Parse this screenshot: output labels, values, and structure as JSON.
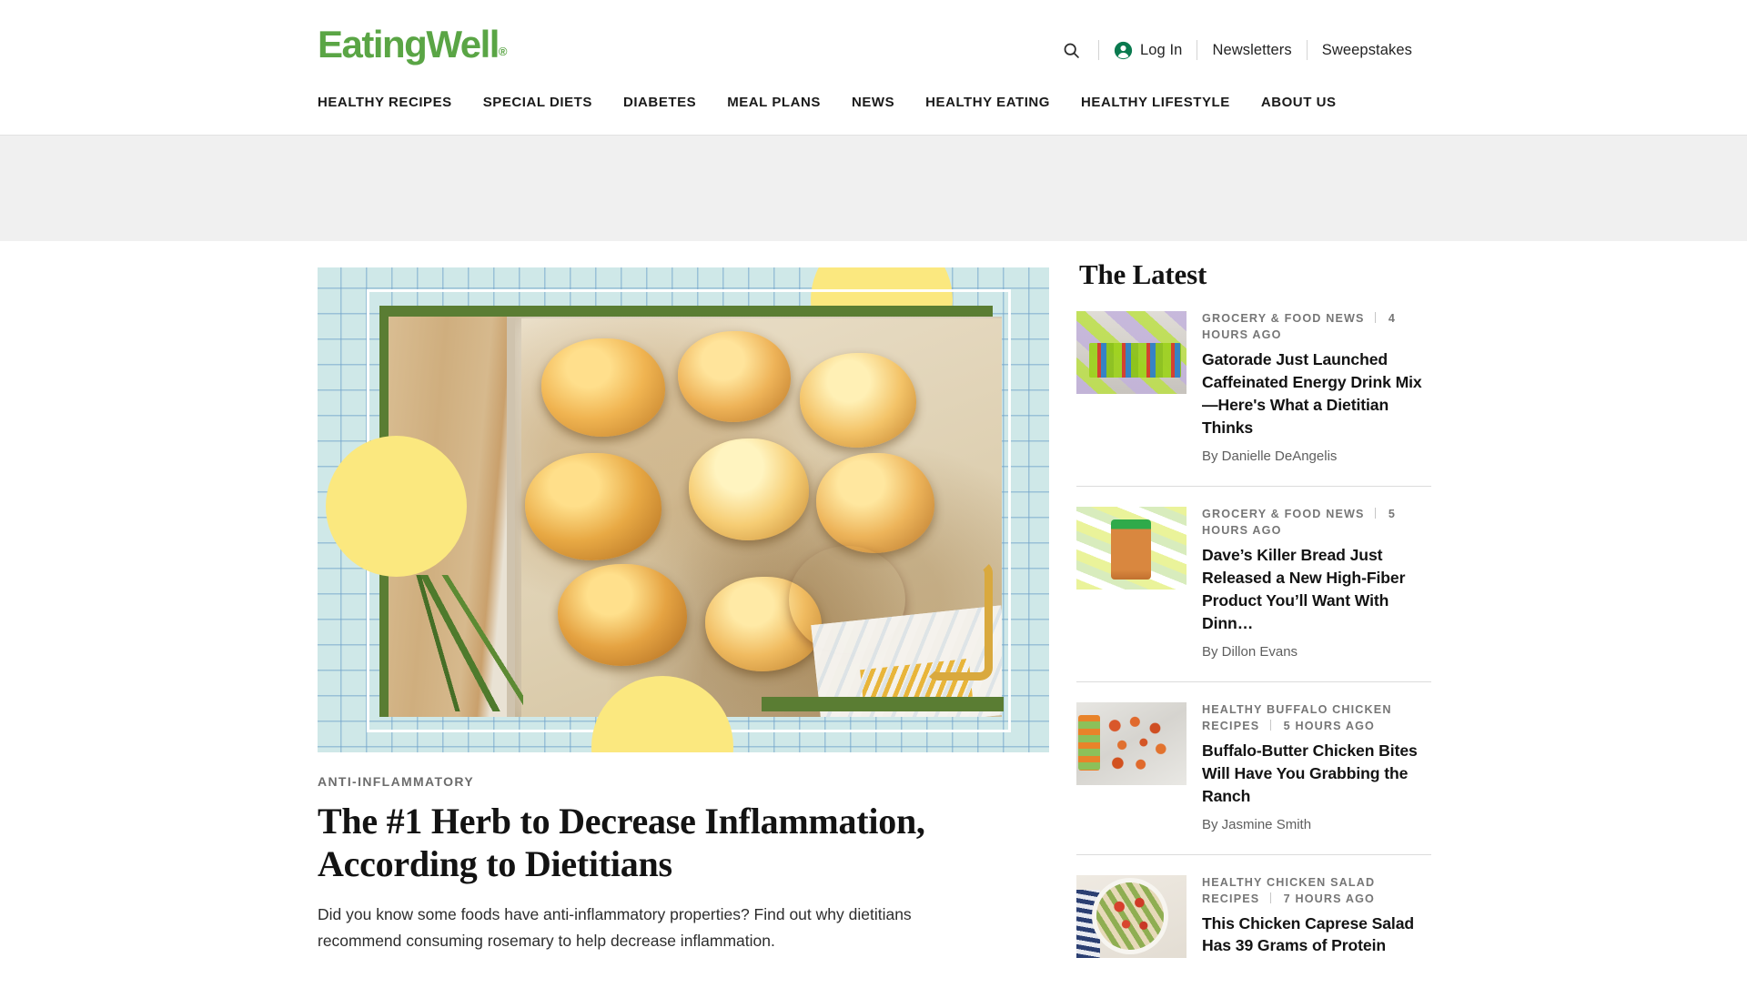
{
  "site": {
    "logo_text": "EatingWell",
    "logo_registered": "®",
    "brand_green": "#5aa545"
  },
  "header": {
    "search_icon": "search-icon",
    "account_icon": "account-circle-icon",
    "login_label": "Log In",
    "newsletters_label": "Newsletters",
    "sweepstakes_label": "Sweepstakes"
  },
  "nav": {
    "items": [
      {
        "label": "HEALTHY RECIPES"
      },
      {
        "label": "SPECIAL DIETS"
      },
      {
        "label": "DIABETES"
      },
      {
        "label": "MEAL PLANS"
      },
      {
        "label": "NEWS"
      },
      {
        "label": "HEALTHY EATING"
      },
      {
        "label": "HEALTHY LIFESTYLE"
      },
      {
        "label": "ABOUT US"
      }
    ]
  },
  "featured": {
    "eyebrow": "ANTI-INFLAMMATORY",
    "title": "The #1 Herb to Decrease Inflammation, According to Dietitians",
    "dek": "Did you know some foods have anti-inflammatory properties? Find out why dietitians recommend consuming rosemary to help decrease inflammation.",
    "image_alt": "sheet-pan of roasted potatoes with rosemary and garlic"
  },
  "sidebar": {
    "heading": "The Latest",
    "highlight_color": "#f7dc5c",
    "items": [
      {
        "category": "GROCERY & FOOD NEWS",
        "time": "4 HOURS AGO",
        "title": "Gatorade Just Launched Caffeinated Energy Drink Mix—Here's What a Dietitian Thinks",
        "byline": "By Danielle DeAngelis",
        "thumb_alt": "Gatorade bottles on a store shelf"
      },
      {
        "category": "GROCERY & FOOD NEWS",
        "time": "5 HOURS AGO",
        "title": "Dave’s Killer Bread Just Released a New High-Fiber Product You’ll Want With Dinn…",
        "byline": "By Dillon Evans",
        "thumb_alt": "loaf of Dave's Killer Bread"
      },
      {
        "category": "HEALTHY BUFFALO CHICKEN RECIPES",
        "time": "5 HOURS AGO",
        "title": "Buffalo-Butter Chicken Bites Will Have You Grabbing the Ranch",
        "byline": "By Jasmine Smith",
        "thumb_alt": "sheet pan of buffalo chicken bites with carrots and celery"
      },
      {
        "category": "HEALTHY CHICKEN SALAD RECIPES",
        "time": "7 HOURS AGO",
        "title": "This Chicken Caprese Salad Has 39 Grams of Protein",
        "byline": "",
        "thumb_alt": "bowl of chicken caprese salad"
      }
    ]
  }
}
